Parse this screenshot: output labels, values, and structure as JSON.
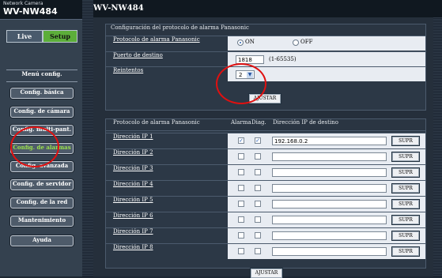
{
  "brand": {
    "line1": "Network Camera",
    "line2": "WV-NW484"
  },
  "model": "WV-NW484",
  "modes": {
    "live": "Live",
    "setup": "Setup"
  },
  "menu": {
    "header": "Menú config.",
    "items": [
      {
        "label": "Config. básica",
        "active": false
      },
      {
        "label": "Config. de cámara",
        "active": false
      },
      {
        "label": "Config. multi-pant.",
        "active": false
      },
      {
        "label": "Config. de alarmas",
        "active": true
      },
      {
        "label": "Config. avanzada",
        "active": false
      },
      {
        "label": "Config. de servidor",
        "active": false
      },
      {
        "label": "Config. de la red",
        "active": false
      },
      {
        "label": "Mantenimiento",
        "active": false
      }
    ],
    "help": "Ayuda"
  },
  "protocol_panel": {
    "title": "Configuración del protocolo de alarma Panasonic",
    "protocol_label": "Protocolo de alarma Panasonic",
    "on_label": "ON",
    "off_label": "OFF",
    "selected": "ON",
    "port_label": "Puerto de destino",
    "port_value": "1818",
    "port_range": "(1-65535)",
    "retries_label": "Reintentos",
    "retries_value": "2",
    "apply_label": "AJUSTAR"
  },
  "ip_panel": {
    "col_protocol": "Protocolo de alarma Panasonic",
    "col_alarm": "Alarma",
    "col_diag": "Diag.",
    "col_ip": "Dirección IP de destino",
    "delete_label": "SUPR",
    "rows": [
      {
        "label": "Dirección IP 1",
        "alarm": true,
        "diag": true,
        "ip": "192.168.0.2"
      },
      {
        "label": "Dirección IP 2",
        "alarm": false,
        "diag": false,
        "ip": ""
      },
      {
        "label": "Dirección IP 3",
        "alarm": false,
        "diag": false,
        "ip": ""
      },
      {
        "label": "Dirección IP 4",
        "alarm": false,
        "diag": false,
        "ip": ""
      },
      {
        "label": "Dirección IP 5",
        "alarm": false,
        "diag": false,
        "ip": ""
      },
      {
        "label": "Dirección IP 6",
        "alarm": false,
        "diag": false,
        "ip": ""
      },
      {
        "label": "Dirección IP 7",
        "alarm": false,
        "diag": false,
        "ip": ""
      },
      {
        "label": "Dirección IP 8",
        "alarm": false,
        "diag": false,
        "ip": ""
      }
    ],
    "apply_label": "AJUSTAR"
  },
  "colors": {
    "accent_green": "#5cae3a",
    "active_text": "#9be24c",
    "annotation_red": "#e01010"
  }
}
